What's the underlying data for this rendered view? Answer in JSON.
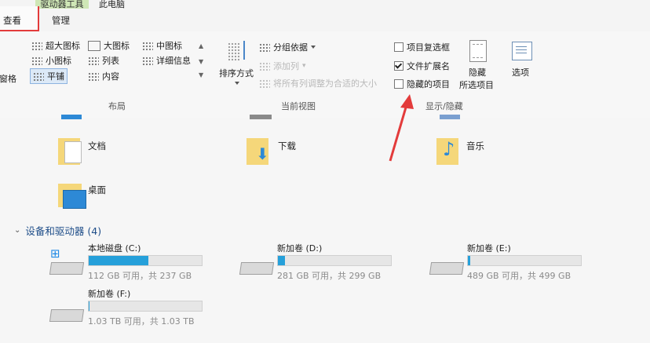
{
  "tabs": {
    "context_label": "驱动器工具",
    "pc_label": "此电脑",
    "view": "查看",
    "manage": "管理"
  },
  "ribbon": {
    "nav_pane_fragment": "窗格",
    "layout": {
      "items": [
        "超大图标",
        "大图标",
        "中图标",
        "小图标",
        "列表",
        "详细信息",
        "平铺",
        "内容"
      ],
      "group_label": "布局"
    },
    "current_view": {
      "sort_label": "排序方式",
      "group_by": "分组依据",
      "add_column": "添加列",
      "fit_columns": "将所有列调整为合适的大小",
      "group_label": "当前视图"
    },
    "show_hide": {
      "item_checkboxes": "项目复选框",
      "file_extensions": "文件扩展名",
      "hidden_items": "隐藏的项目",
      "hide_selected_1": "隐藏",
      "hide_selected_2": "所选项目",
      "options": "选项",
      "group_label": "显示/隐藏"
    }
  },
  "folders": [
    {
      "name": "文档"
    },
    {
      "name": "下载"
    },
    {
      "name": "音乐"
    },
    {
      "name": "桌面"
    }
  ],
  "devices": {
    "header": "设备和驱动器 (4)",
    "drives": [
      {
        "name": "本地磁盘 (C:)",
        "info": "112 GB 可用，共 237 GB",
        "used_fraction": 0.53
      },
      {
        "name": "新加卷 (D:)",
        "info": "281 GB 可用，共 299 GB",
        "used_fraction": 0.06
      },
      {
        "name": "新加卷 (E:)",
        "info": "489 GB 可用，共 499 GB",
        "used_fraction": 0.02
      },
      {
        "name": "新加卷 (F:)",
        "info": "1.03 TB 可用，共 1.03 TB",
        "used_fraction": 0.01
      }
    ]
  },
  "colors": {
    "accent": "#26a0da",
    "annotation": "#e33b3b"
  }
}
